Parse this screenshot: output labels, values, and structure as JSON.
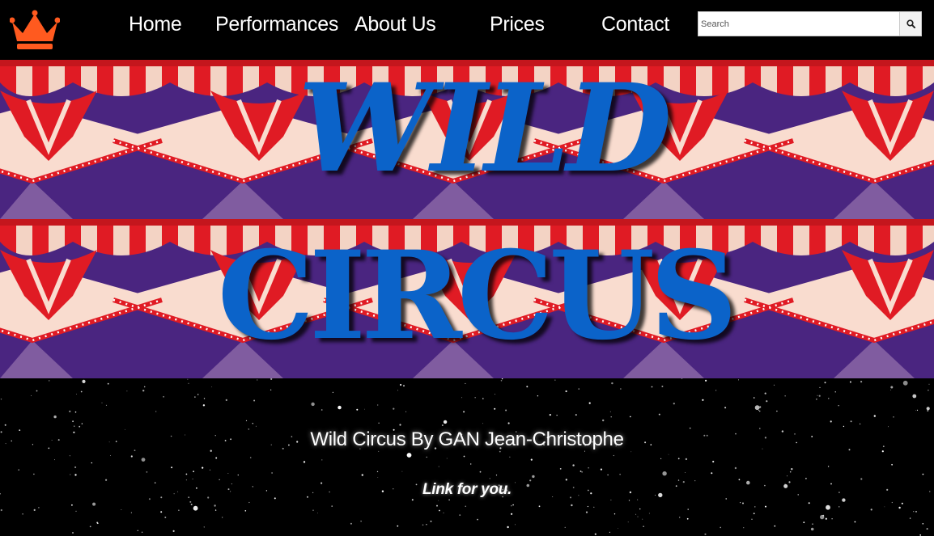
{
  "nav": {
    "logo_icon": "crown-icon",
    "logo_color": "#ff5a1f",
    "links": [
      {
        "label": "Home"
      },
      {
        "label": "Performances"
      },
      {
        "label": "About Us"
      },
      {
        "label": "Prices"
      },
      {
        "label": "Contact"
      }
    ],
    "search": {
      "placeholder": "Search",
      "value": "",
      "button_icon": "search-icon"
    }
  },
  "hero": {
    "line1": "WILD",
    "line2": "CIRCUS",
    "title_color": "#0b63c9",
    "background": "red-and-white circus tent canopy pattern",
    "colors": {
      "red": "#e01b24",
      "cream": "#f9dccf",
      "purple": "#4a2580"
    }
  },
  "footer": {
    "tagline": "Wild Circus By GAN Jean-Christophe",
    "link_text": "Link for you."
  }
}
